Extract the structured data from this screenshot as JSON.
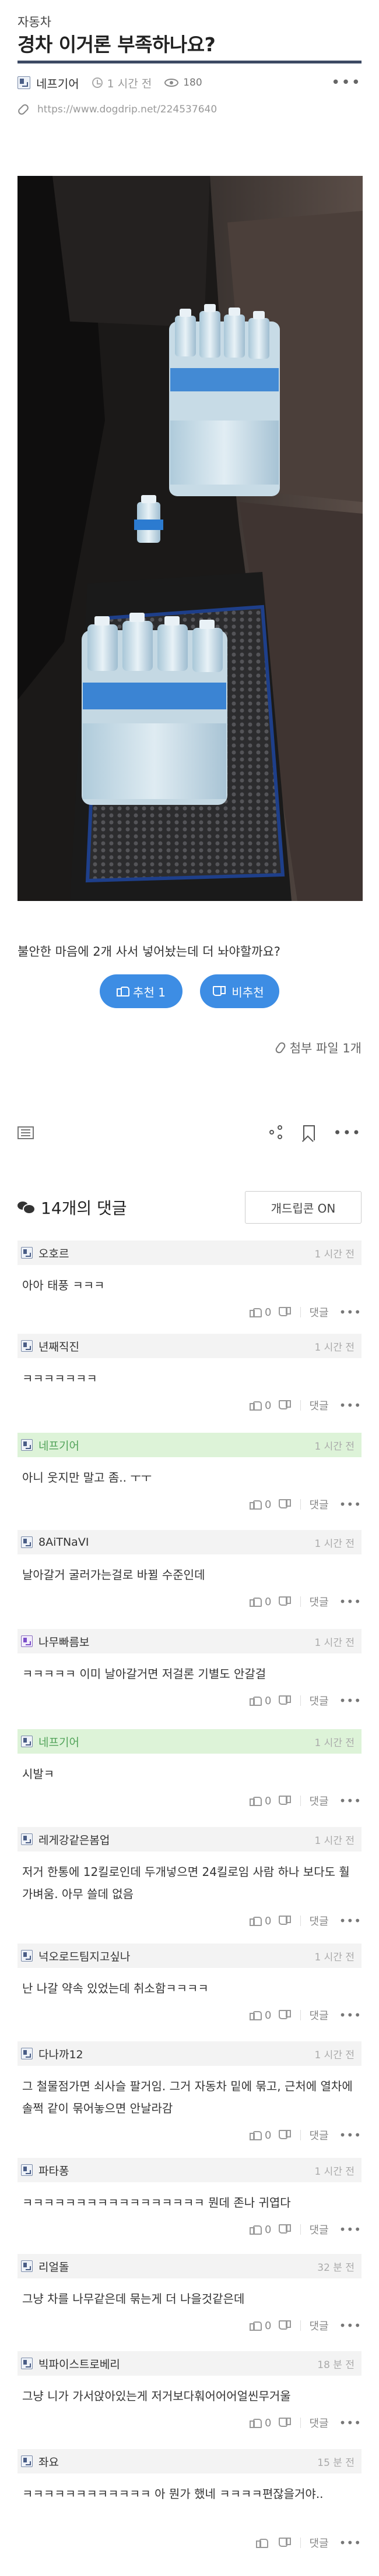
{
  "post": {
    "category": "자동차",
    "title": "경차 이거론 부족하나요?",
    "author": "네프기어",
    "time": "1 시간 전",
    "views": "180",
    "url": "https://www.dogdrip.net/224537640",
    "body": "불안한 마음에 2개 사서 넣어놨는데 더 놔야할까요?",
    "upvote_label": "추천 1",
    "downvote_label": "비추천",
    "attachment": "첨부 파일 1개",
    "photo_alt": "승용차 조수석 바닥과 시트 위에 놓인 생수 묶음 2팩"
  },
  "comments_header": {
    "count_label": "14개의 댓글",
    "dog_button": "개드립콘 ON"
  },
  "comment_actions": {
    "reply": "댓글"
  },
  "comments": [
    {
      "author": "오호르",
      "time": "1 시간 전",
      "body": "아아 태풍 ㅋㅋㅋ",
      "up": "0",
      "op": false,
      "badge": "blue"
    },
    {
      "author": "년째직진",
      "time": "1 시간 전",
      "body": "ㅋㅋㅋㅋㅋㅋㅋ",
      "up": "0",
      "op": false,
      "badge": "blue"
    },
    {
      "author": "네프기어",
      "time": "1 시간 전",
      "body": "아니 웃지만 말고 좀.. ㅜㅜ",
      "up": "0",
      "op": true,
      "badge": "blue"
    },
    {
      "author": "8AiTNaVI",
      "time": "1 시간 전",
      "body": "날아갈거 굴러가는걸로 바뀔 수준인데",
      "up": "0",
      "op": false,
      "badge": "blue"
    },
    {
      "author": "나무빠름보",
      "time": "1 시간 전",
      "body": "ㅋㅋㅋㅋㅋ 이미 날아갈거면 저걸론 기별도 안갈걸",
      "up": "0",
      "op": false,
      "badge": "purple"
    },
    {
      "author": "네프기어",
      "time": "1 시간 전",
      "body": "시발ㅋ",
      "up": "0",
      "op": true,
      "badge": "blue"
    },
    {
      "author": "레게강같은봄업",
      "time": "1 시간 전",
      "body": "저거 한통에 12킬로인데 두개넣으면 24킬로임 사람 하나 보다도 훨 가벼움. 아무 쓸데 없음",
      "up": "0",
      "op": false,
      "badge": "blue"
    },
    {
      "author": "넉오로드팀지고싶나",
      "time": "1 시간 전",
      "body": "난 나갈 약속 있었는데 취소함ㅋㅋㅋㅋ",
      "up": "0",
      "op": false,
      "badge": "blue"
    },
    {
      "author": "다나까12",
      "time": "1 시간 전",
      "body": "그 철물점가면 쇠사슬 팔거임. 그거 자동차 밑에 묶고, 근처에 열차에 솔쩍 같이 묶어놓으면 안날라감",
      "up": "0",
      "op": false,
      "badge": "blue"
    },
    {
      "author": "파타퐁",
      "time": "1 시간 전",
      "body": "ㅋㅋㅋㅋㅋㅋㅋㅋㅋㅋㅋㅋㅋㅋㅋㅋㅋ 뭔데 존나 귀엽다",
      "up": "0",
      "op": false,
      "badge": "blue"
    },
    {
      "author": "리얼돌",
      "time": "32 분 전",
      "body": "그냥 차를 나무같은데 묶는게 더 나을것같은데",
      "up": "0",
      "op": false,
      "badge": "blue"
    },
    {
      "author": "빅파이스트로베리",
      "time": "18 분 전",
      "body": "그냥 니가 가서앉아있는게 저거보다훠어어어얼씬무거울",
      "up": "0",
      "op": false,
      "badge": "blue"
    },
    {
      "author": "좌요",
      "time": "15 분 전",
      "body": "ㅋㅋㅋㅋㅋㅋㅋㅋㅋㅋㅋㅋ 아 뭔가 했네 ㅋㅋㅋㅋ편잖을거야..",
      "up": "",
      "op": false,
      "badge": "blue"
    }
  ]
}
